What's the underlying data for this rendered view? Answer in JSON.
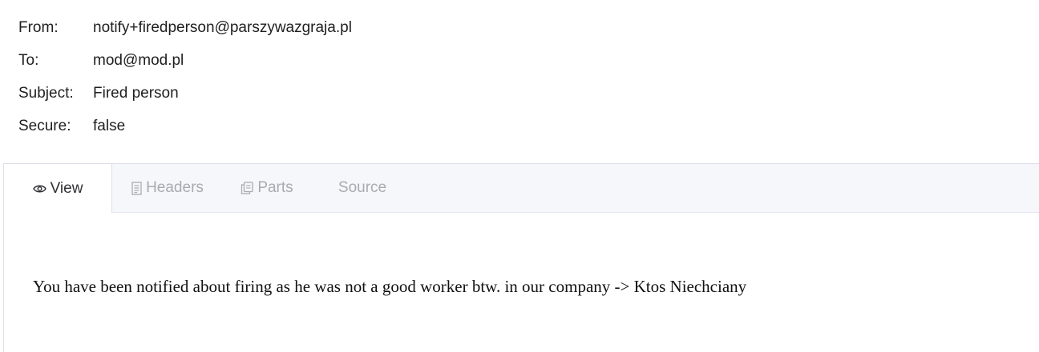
{
  "headers": [
    {
      "label": "From:",
      "value": "notify+firedperson@parszywazgraja.pl"
    },
    {
      "label": "To:",
      "value": "mod@mod.pl"
    },
    {
      "label": "Subject:",
      "value": "Fired person"
    },
    {
      "label": "Secure:",
      "value": "false"
    }
  ],
  "tabs": {
    "view": {
      "label": "View",
      "icon": "eye-icon",
      "active": true
    },
    "headers": {
      "label": "Headers",
      "icon": "document-icon",
      "active": false
    },
    "parts": {
      "label": "Parts",
      "icon": "copy-icon",
      "active": false
    },
    "source": {
      "label": "Source",
      "active": false
    }
  },
  "body": {
    "text": "You have been notified about firing as he was not a good worker btw. in our company -> Ktos Niechciany"
  },
  "colors": {
    "tab_bar_bg": "#f5f7fa",
    "tab_inactive_text": "#a8abb2",
    "tab_active_text": "#303133",
    "border": "#dcdfe6"
  }
}
